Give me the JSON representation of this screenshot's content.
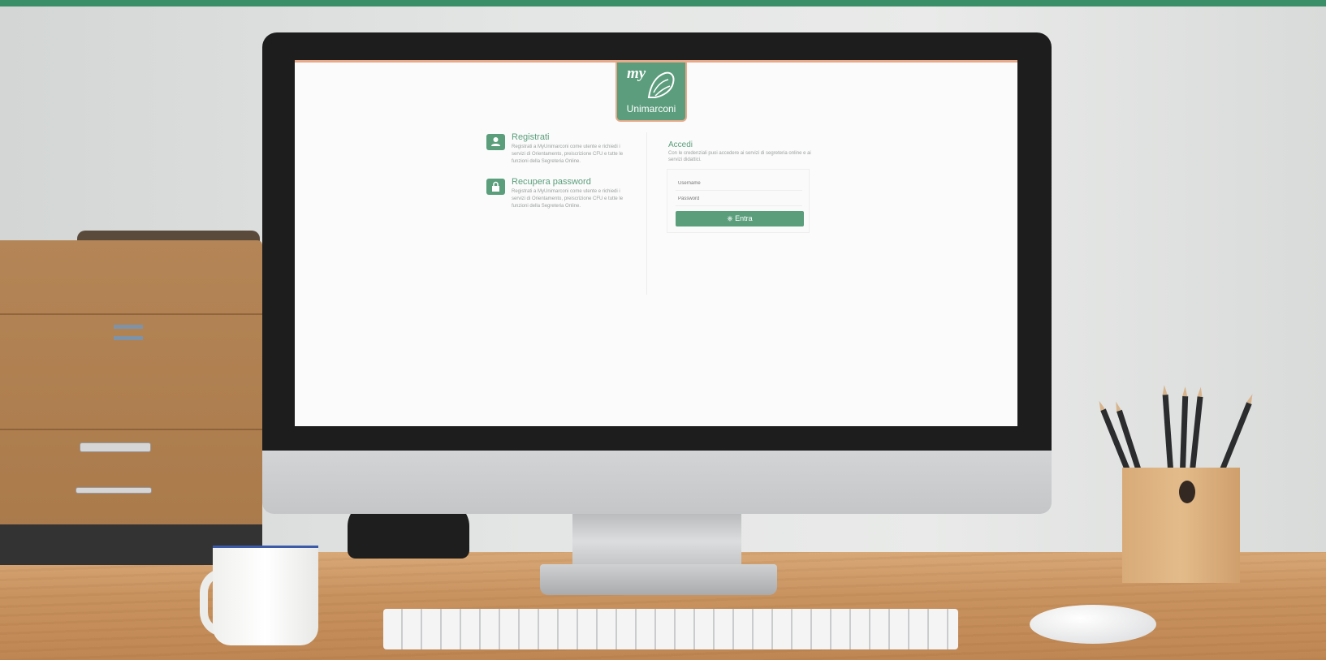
{
  "brand": {
    "accent": "#5a9e7c",
    "top_bar": "#3a8f68",
    "logo_border": "#e6a989"
  },
  "logo": {
    "my": "my",
    "name": "Unimarconi"
  },
  "left": {
    "items": [
      {
        "icon": "user-icon",
        "title": "Registrati",
        "description": "Registrati a MyUnimarconi come utente e richiedi i servizi di Orientamento, preiscrizione CFU e tutte le funzioni della Segreteria Online."
      },
      {
        "icon": "lock-icon",
        "title": "Recupera password",
        "description": "Registrati a MyUnimarconi come utente e richiedi i servizi di Orientamento, preiscrizione CFU e tutte le funzioni della Segreteria Online."
      }
    ]
  },
  "login": {
    "title": "Accedi",
    "description": "Con le credenziali puoi accedere ai servizi di segreteria online e ai servizi didattici.",
    "username_placeholder": "Username",
    "password_placeholder": "Password",
    "submit_label": "Entra",
    "submit_icon": "login-icon"
  }
}
